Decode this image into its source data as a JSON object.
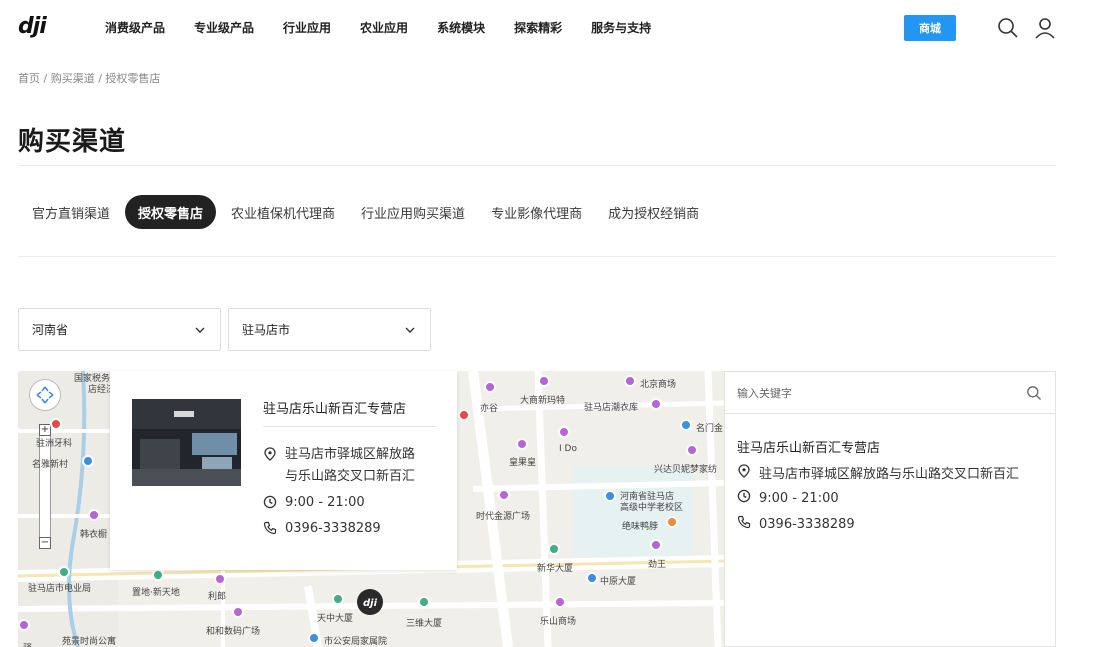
{
  "header": {
    "logo": "dji",
    "nav": [
      "消费级产品",
      "专业级产品",
      "行业应用",
      "农业应用",
      "系统模块",
      "探索精彩",
      "服务与支持"
    ],
    "shop_label": "商城"
  },
  "breadcrumb": [
    "首页",
    "购买渠道",
    "授权零售店"
  ],
  "page_title": "购买渠道",
  "tabs": [
    "官方直销渠道",
    "授权零售店",
    "农业植保机代理商",
    "行业应用购买渠道",
    "专业影像代理商",
    "成为授权经销商"
  ],
  "active_tab": "授权零售店",
  "filters": {
    "province": "河南省",
    "city": "驻马店市"
  },
  "map": {
    "labels": [
      "国家税务",
      "店经济",
      "驻洲牙科",
      "名雅新村",
      "亦谷",
      "大商新玛特",
      "北京商场",
      "驻马店潮衣库",
      "名门金",
      "I Do",
      "皇果皇",
      "兴达贝妮梦家纺",
      "河南省驻马店",
      "高级中学老校区",
      "绝味鸭脖",
      "时代金源广场",
      "韩衣橱",
      "新华大厦",
      "劲王",
      "中原大厦",
      "驻马店市电业局",
      "置地·新天地",
      "利郎",
      "天中大厦",
      "三维大厦",
      "和和数码广场",
      "乐山商场",
      "苑景时尚公寓",
      "市公安局家属院",
      "驿"
    ],
    "card": {
      "name": "驻马店乐山新百汇专营店",
      "address_line1": "驻马店市驿城区解放路",
      "address_line2": "与乐山路交叉口新百汇",
      "hours": "9:00 - 21:00",
      "phone": "0396-3338289"
    }
  },
  "panel": {
    "search_placeholder": "输入关键字",
    "store": {
      "name": "驻马店乐山新百汇专营店",
      "address": "驻马店市驿城区解放路与乐山路交叉口新百汇",
      "hours": "9:00 - 21:00",
      "phone": "0396-3338289"
    }
  },
  "colors": {
    "shop_button": "#2196f3",
    "active_tab_bg": "#222222"
  }
}
